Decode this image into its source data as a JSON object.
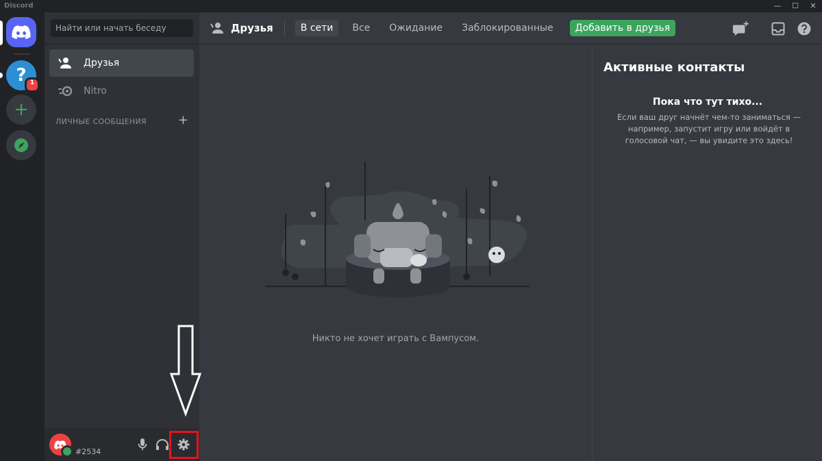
{
  "window": {
    "brand": "Discord",
    "controls": [
      "—",
      "☐",
      "✕"
    ]
  },
  "rail": {
    "home_icon": "discord-logo-icon",
    "servers": [
      {
        "name": "help-server",
        "glyph": "?",
        "badge": "1",
        "color": "#2b8fd6"
      }
    ],
    "add_glyph": "+",
    "explore_icon": "compass-icon"
  },
  "sidebar": {
    "search_placeholder": "Найти или начать беседу",
    "items": [
      {
        "label": "Друзья",
        "icon": "friends-icon",
        "active": true
      },
      {
        "label": "Nitro",
        "icon": "nitro-icon",
        "active": false
      }
    ],
    "dm_header": "ЛИЧНЫЕ СООБЩЕНИЯ",
    "dm_add": "+"
  },
  "user_panel": {
    "tag": "#2534",
    "status": "online",
    "controls": [
      "microphone-icon",
      "headphones-icon",
      "settings-gear-icon"
    ]
  },
  "header": {
    "title": "Друзья",
    "tabs": [
      {
        "label": "В сети",
        "active": true
      },
      {
        "label": "Все",
        "active": false
      },
      {
        "label": "Ожидание",
        "active": false
      },
      {
        "label": "Заблокированные",
        "active": false
      }
    ],
    "add_friend": "Добавить в друзья",
    "icons": [
      "new-group-dm-icon",
      "inbox-icon",
      "help-icon"
    ]
  },
  "main": {
    "empty_illustration": "wumpus-sleeping-illustration",
    "empty_text": "Никто не хочет играть с Вампусом."
  },
  "activity": {
    "title": "Активные контакты",
    "empty_title": "Пока что тут тихо...",
    "empty_text": "Если ваш друг начнёт чем-то заниматься — например, запустит игру или войдёт в голосовой чат, — вы увидите это здесь!"
  },
  "annotation": {
    "highlight_color": "#e8121d",
    "target": "settings-gear-icon",
    "arrow_direction": "down"
  },
  "colors": {
    "blurple": "#5865f2",
    "green": "#3ba55d",
    "red": "#ed4245"
  }
}
